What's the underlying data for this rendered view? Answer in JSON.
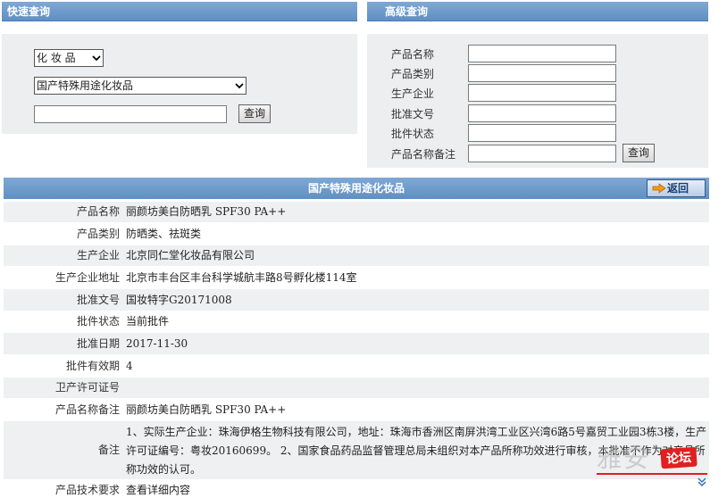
{
  "quick_search": {
    "title": "快速查询",
    "category_select": "化 妆 品",
    "subcategory_select": "国产特殊用途化妆品",
    "keyword_value": "",
    "search_button": "查询"
  },
  "advanced_search": {
    "title": "高级查询",
    "fields": [
      {
        "label": "产品名称",
        "value": ""
      },
      {
        "label": "产品类别",
        "value": ""
      },
      {
        "label": "生产企业",
        "value": ""
      },
      {
        "label": "批准文号",
        "value": ""
      },
      {
        "label": "批件状态",
        "value": ""
      },
      {
        "label": "产品名称备注",
        "value": ""
      }
    ],
    "search_button": "查询"
  },
  "result": {
    "header": "国产特殊用途化妆品",
    "back_button": "返回",
    "rows": [
      {
        "label": "产品名称",
        "value": "丽颜坊美白防晒乳 SPF30 PA++"
      },
      {
        "label": "产品类别",
        "value": "防晒类、祛斑类"
      },
      {
        "label": "生产企业",
        "value": "北京同仁堂化妆品有限公司"
      },
      {
        "label": "生产企业地址",
        "value": "北京市丰台区丰台科学城航丰路8号孵化楼114室"
      },
      {
        "label": "批准文号",
        "value": "国妆特字G20171008"
      },
      {
        "label": "批件状态",
        "value": "当前批件"
      },
      {
        "label": "批准日期",
        "value": "2017-11-30"
      },
      {
        "label": "批件有效期",
        "value": "4"
      },
      {
        "label": "卫产许可证号",
        "value": ""
      },
      {
        "label": "产品名称备注",
        "value": "丽颜坊美白防晒乳 SPF30 PA++"
      },
      {
        "label": "备注",
        "value": "1、实际生产企业：珠海伊格生物科技有限公司，地址：珠海市香洲区南屏洪湾工业区兴湾6路5号嘉贸工业园3栋3楼，生产许可证编号：粤妆20160699。 2、国家食品药品监督管理总局未组织对本产品所称功效进行审核，本批准不作为对产品所称功效的认可。"
      },
      {
        "label": "产品技术要求",
        "value": "查看详细内容"
      }
    ]
  },
  "watermark": {
    "text": "雅安",
    "badge": "论坛"
  },
  "colors": {
    "header_blue": "#6a98c9",
    "row_shade": "#eef0f1",
    "panel_gray": "#eceeef",
    "watermark_red": "#e02020"
  }
}
